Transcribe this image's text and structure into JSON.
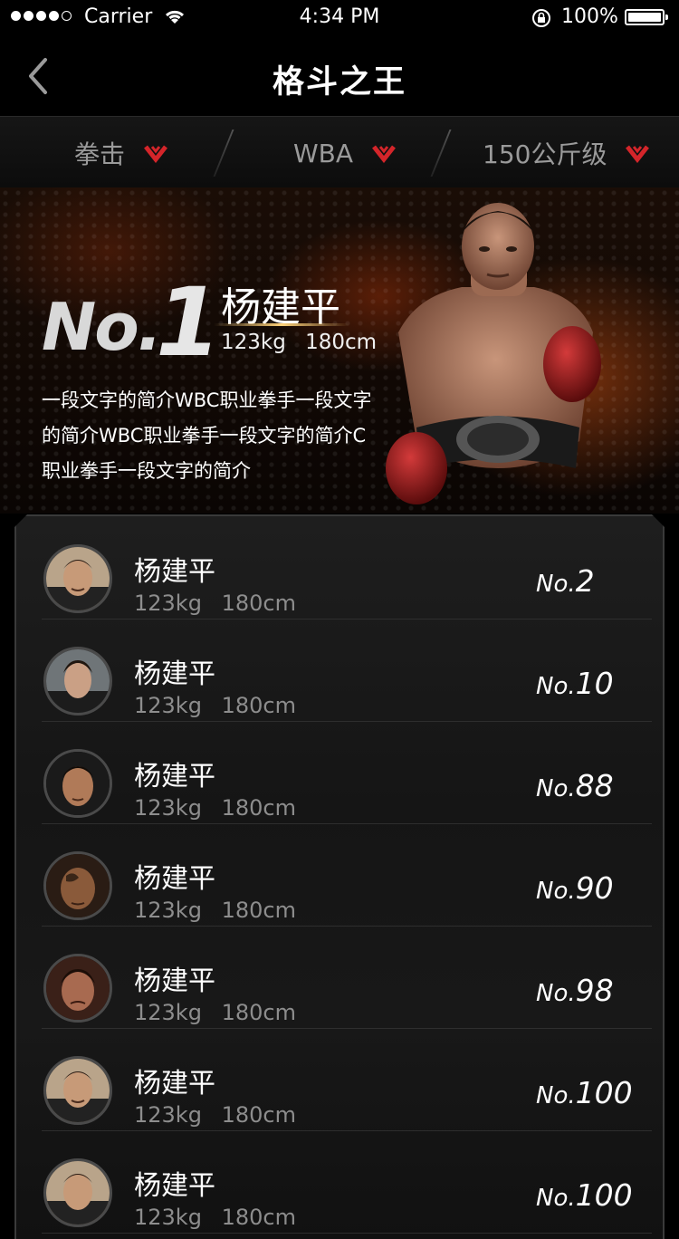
{
  "status_bar": {
    "carrier": "Carrier",
    "time": "4:34 PM",
    "battery": "100%"
  },
  "nav": {
    "title": "格斗之王"
  },
  "filters": [
    {
      "label": "拳击"
    },
    {
      "label": "WBA"
    },
    {
      "label": "150公斤级"
    }
  ],
  "colors": {
    "accent": "#d4252a",
    "background": "#000000"
  },
  "champion": {
    "rank_prefix": "No.",
    "rank_number": "1",
    "name": "杨建平",
    "weight": "123kg",
    "height": "180cm",
    "description_lines": [
      "一段文字的简介WBC职业拳手一段文字",
      "的简介WBC职业拳手一段文字的简介C",
      "职业拳手一段文字的简介"
    ]
  },
  "ranking_list": [
    {
      "name": "杨建平",
      "weight": "123kg",
      "height": "180cm",
      "rank_prefix": "No.",
      "rank": "2",
      "avatar": "avatar-photo"
    },
    {
      "name": "杨建平",
      "weight": "123kg",
      "height": "180cm",
      "rank_prefix": "No.",
      "rank": "10",
      "avatar": "avatar-photo"
    },
    {
      "name": "杨建平",
      "weight": "123kg",
      "height": "180cm",
      "rank_prefix": "No.",
      "rank": "88",
      "avatar": "avatar-photo"
    },
    {
      "name": "杨建平",
      "weight": "123kg",
      "height": "180cm",
      "rank_prefix": "No.",
      "rank": "90",
      "avatar": "avatar-photo"
    },
    {
      "name": "杨建平",
      "weight": "123kg",
      "height": "180cm",
      "rank_prefix": "No.",
      "rank": "98",
      "avatar": "avatar-photo"
    },
    {
      "name": "杨建平",
      "weight": "123kg",
      "height": "180cm",
      "rank_prefix": "No.",
      "rank": "100",
      "avatar": "avatar-photo"
    },
    {
      "name": "杨建平",
      "weight": "123kg",
      "height": "180cm",
      "rank_prefix": "No.",
      "rank": "100",
      "avatar": "avatar-photo"
    }
  ]
}
